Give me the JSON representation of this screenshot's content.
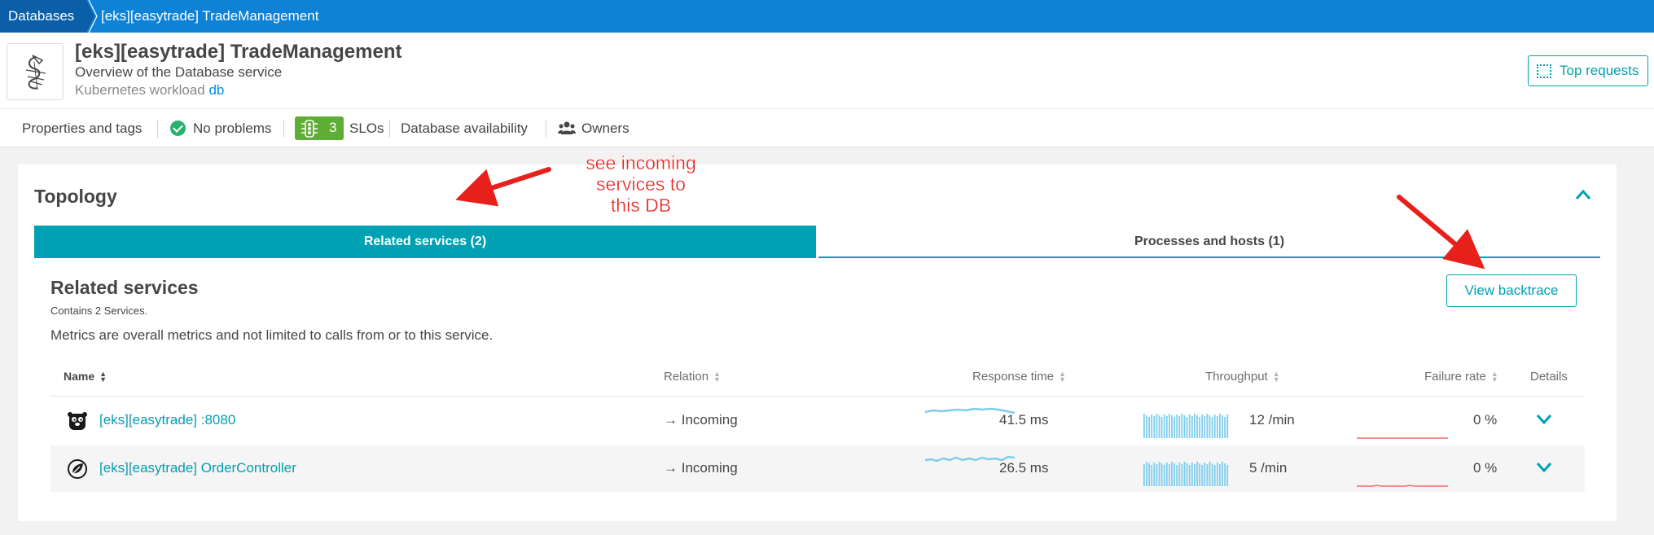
{
  "breadcrumb": {
    "items": [
      "Databases",
      "[eks][easytrade] TradeManagement"
    ]
  },
  "header": {
    "title": "[eks][easytrade] TradeManagement",
    "subtitle": "Overview of the Database service",
    "workload_prefix": "Kubernetes workload",
    "workload_link": "db",
    "icon": "database-service-icon",
    "top_requests_label": "Top requests"
  },
  "properties_bar": {
    "properties": "Properties and tags",
    "problems": "No problems",
    "slo_count": "3",
    "slo_label": "SLOs",
    "availability": "Database availability",
    "owners": "Owners"
  },
  "topology": {
    "title": "Topology",
    "tabs": [
      {
        "label": "Related services (2)",
        "active": true
      },
      {
        "label": "Processes and hosts (1)",
        "active": false
      }
    ],
    "section_title": "Related services",
    "section_sub": "Contains 2 Services.",
    "note": "Metrics are overall metrics and not limited to calls from or to this service.",
    "backtrace_label": "View backtrace",
    "columns": [
      "Name",
      "Relation",
      "Response time",
      "Throughput",
      "Failure rate",
      "Details"
    ],
    "rows": [
      {
        "name": "[eks][easytrade] :8080",
        "icon": "go-gopher-icon",
        "relation": "→ Incoming",
        "response_time": "41.5 ms",
        "throughput": "12 /min",
        "failure_rate": "0 %"
      },
      {
        "name": "[eks][easytrade] OrderController",
        "icon": "spring-leaf-icon",
        "relation": "→ Incoming",
        "response_time": "26.5 ms",
        "throughput": "5 /min",
        "failure_rate": "0 %"
      }
    ]
  },
  "annotation": {
    "text_lines": [
      "see incoming",
      "services to",
      "this DB"
    ]
  },
  "colors": {
    "brand_blue": "#0e82d6",
    "teal": "#00a1b2",
    "success_green": "#2ab06f",
    "slo_green": "#5ead35",
    "annotation_red": "#e8201b",
    "spark_blue": "#7fcdec",
    "spark_red": "#f06d6d"
  }
}
